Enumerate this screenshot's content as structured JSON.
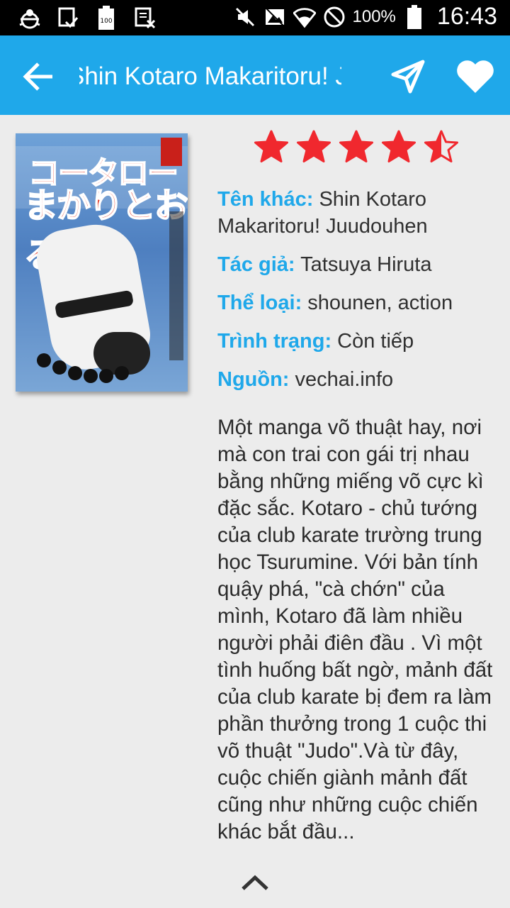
{
  "status_bar": {
    "battery_percent": "100%",
    "time": "16:43",
    "icons_left": [
      "android-debug-icon",
      "screenshot-icon",
      "battery-saver-icon",
      "no-sim-icon"
    ],
    "icons_right": [
      "mute-icon",
      "no-image-icon",
      "wifi-icon",
      "do-not-disturb-icon",
      "battery-icon"
    ]
  },
  "app_bar": {
    "title": "Shin Kotaro Makaritoru! Juudouhen",
    "back_icon": "arrow-left-icon",
    "share_icon": "navigation-icon",
    "favorite_icon": "heart-icon",
    "color": "#1fa8ea"
  },
  "cover": {
    "title_line1": "コータロー",
    "title_line2": "まかりとおる!"
  },
  "rating": {
    "value": 4.5,
    "max": 5,
    "color": "#f0282e"
  },
  "info": {
    "other_name_label": "Tên khác:",
    "other_name_value": "Shin Kotaro Makaritoru! Juudouhen",
    "author_label": "Tác giả:",
    "author_value": "Tatsuya Hiruta",
    "genre_label": "Thể loại:",
    "genre_value": "shounen, action",
    "status_label": "Trình trạng:",
    "status_value": "Còn tiếp",
    "source_label": "Nguồn:",
    "source_value": "vechai.info"
  },
  "description": "Một manga võ thuật hay, nơi mà con trai con gái trị nhau bằng những miếng võ cực kì đặc sắc. Kotaro - chủ tướng của club karate trường trung học Tsurumine. Với bản tính quậy phá, \"cà chớn\" của mình, Kotaro đã làm nhiều người phải điên đầu . Vì một tình huống bất ngờ, mảnh đất của club karate bị đem ra làm phần thưởng trong 1 cuộc thi võ thuật \"Judo\".Và từ đây, cuộc chiến giành mảnh đất cũng như những cuộc chiến khác bắt đầu...",
  "bottom": {
    "expand_icon": "chevron-up-icon"
  }
}
